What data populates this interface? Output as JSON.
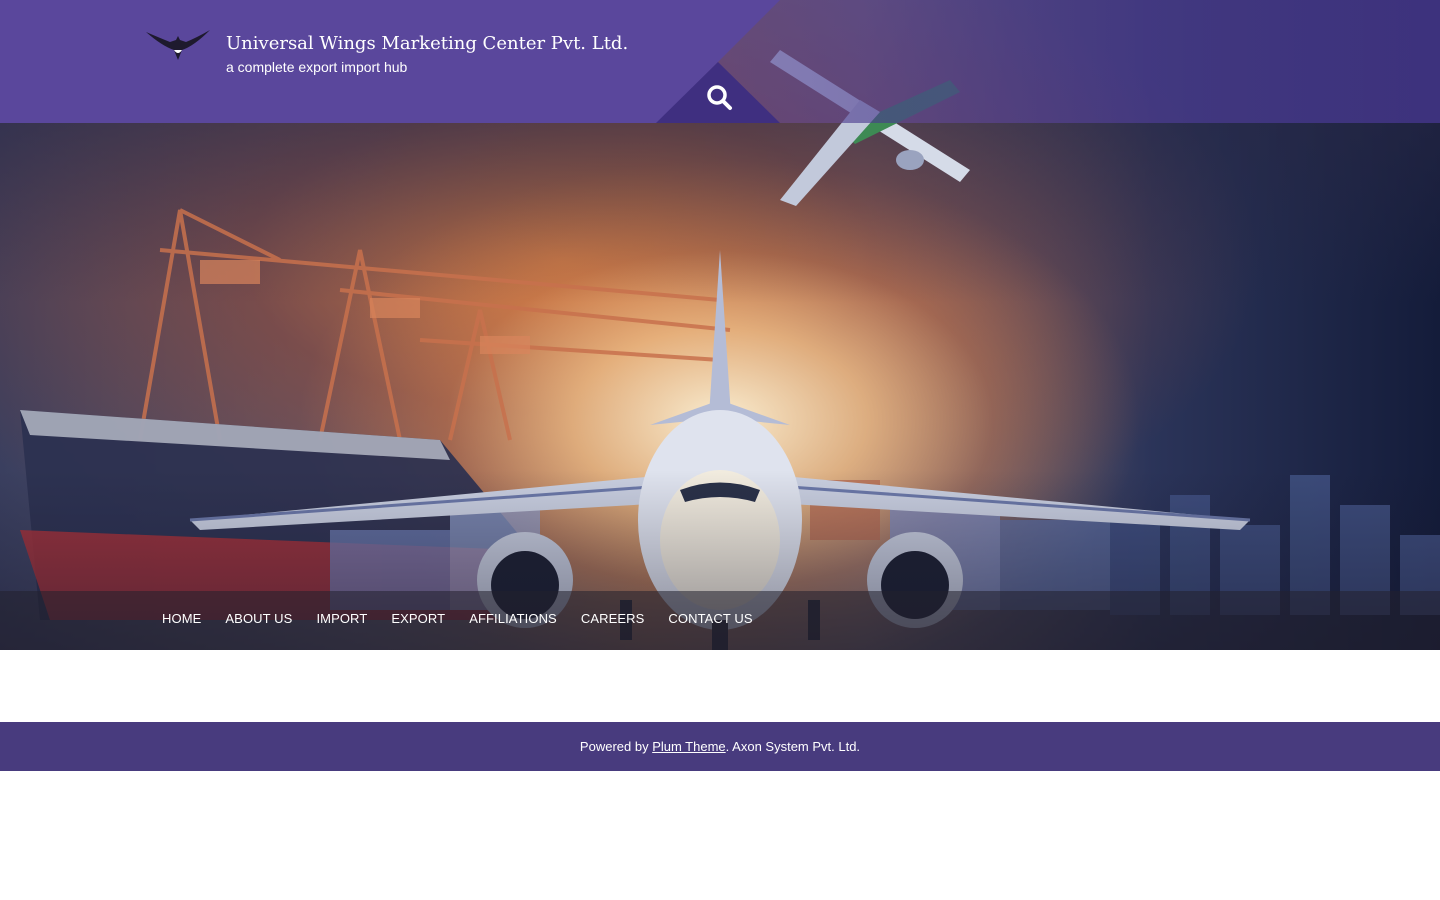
{
  "site": {
    "title": "Universal Wings Marketing Center Pvt. Ltd.",
    "tagline": "a complete export import hub",
    "logo_icon": "eagle-logo-icon"
  },
  "header": {
    "search_icon": "search-icon"
  },
  "nav": {
    "items": [
      {
        "label": "HOME"
      },
      {
        "label": "ABOUT US"
      },
      {
        "label": "IMPORT"
      },
      {
        "label": "EXPORT"
      },
      {
        "label": "AFFILIATIONS"
      },
      {
        "label": "CAREERS"
      },
      {
        "label": "CONTACT US"
      }
    ]
  },
  "footer": {
    "prefix": "Powered by ",
    "link_label": "Plum Theme",
    "suffix": ". Axon System Pvt. Ltd."
  },
  "colors": {
    "header_purple": "#5a479c",
    "footer_purple": "#483b7e"
  }
}
